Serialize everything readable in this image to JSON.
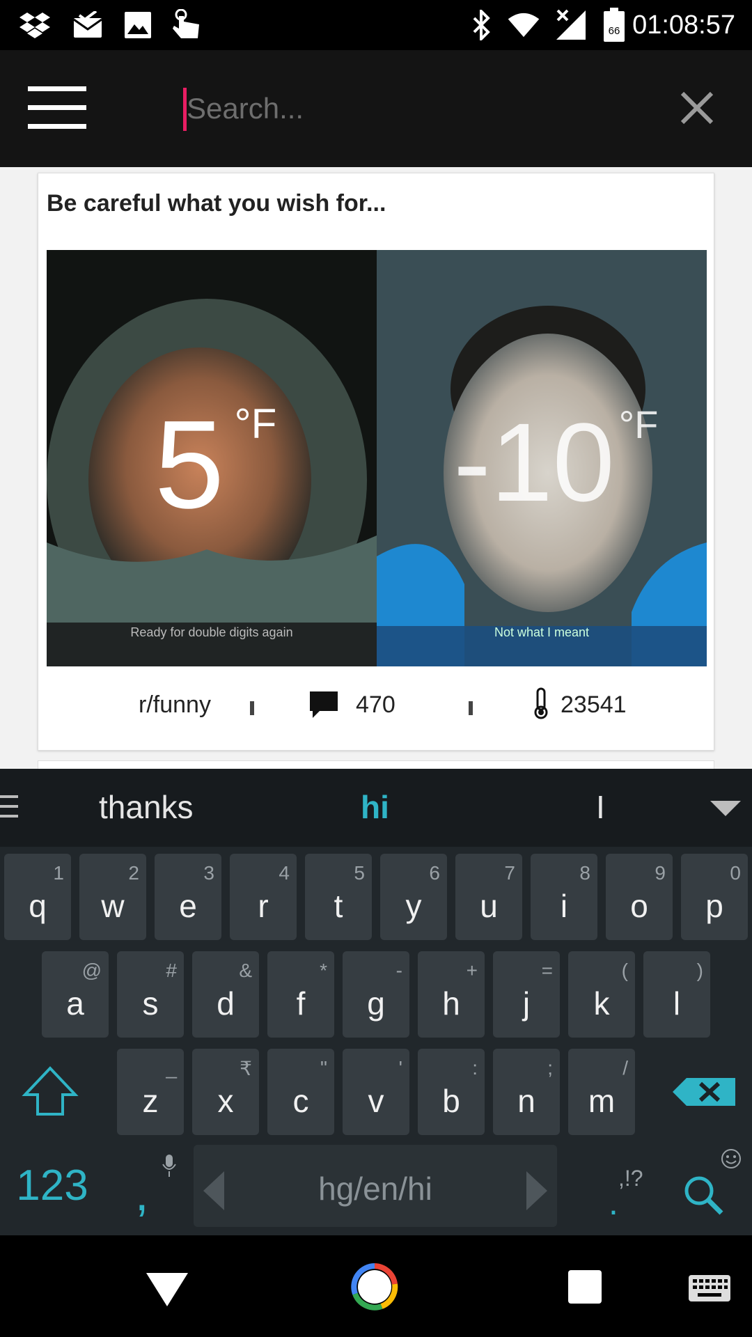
{
  "status_bar": {
    "time": "01:08:57",
    "battery_level": "66",
    "icons": [
      "dropbox-icon",
      "mail-icon",
      "image-icon",
      "touch-icon",
      "bluetooth-icon",
      "wifi-icon",
      "signal-icon",
      "battery-icon"
    ]
  },
  "app_bar": {
    "menu_icon": "hamburger-menu-icon",
    "search_placeholder": "Search...",
    "close_icon": "close-icon"
  },
  "post": {
    "title": "Be careful what you wish for...",
    "image_left_text": "5",
    "image_left_unit": "°F",
    "image_left_caption": "Ready for double digits again",
    "image_right_text": "-10",
    "image_right_unit": "°F",
    "image_right_caption": "Not what I meant",
    "subreddit": "r/funny",
    "comments": "470",
    "score": "23541"
  },
  "keyboard": {
    "suggestions": {
      "left": "thanks",
      "center": "hi",
      "right": "I"
    },
    "row1": [
      {
        "letter": "q",
        "hint": "1"
      },
      {
        "letter": "w",
        "hint": "2"
      },
      {
        "letter": "e",
        "hint": "3"
      },
      {
        "letter": "r",
        "hint": "4"
      },
      {
        "letter": "t",
        "hint": "5"
      },
      {
        "letter": "y",
        "hint": "6"
      },
      {
        "letter": "u",
        "hint": "7"
      },
      {
        "letter": "i",
        "hint": "8"
      },
      {
        "letter": "o",
        "hint": "9"
      },
      {
        "letter": "p",
        "hint": "0"
      }
    ],
    "row2": [
      {
        "letter": "a",
        "hint": "@"
      },
      {
        "letter": "s",
        "hint": "#"
      },
      {
        "letter": "d",
        "hint": "&"
      },
      {
        "letter": "f",
        "hint": "*"
      },
      {
        "letter": "g",
        "hint": "-"
      },
      {
        "letter": "h",
        "hint": "+"
      },
      {
        "letter": "j",
        "hint": "="
      },
      {
        "letter": "k",
        "hint": "("
      },
      {
        "letter": "l",
        "hint": ")"
      }
    ],
    "row3": [
      {
        "letter": "z",
        "hint": "_"
      },
      {
        "letter": "x",
        "hint": "₹"
      },
      {
        "letter": "c",
        "hint": "\""
      },
      {
        "letter": "v",
        "hint": "'"
      },
      {
        "letter": "b",
        "hint": ":"
      },
      {
        "letter": "n",
        "hint": ";"
      },
      {
        "letter": "m",
        "hint": "/"
      }
    ],
    "num_label": "123",
    "comma_label": ",",
    "space_label": "hg/en/hi",
    "punct_top": ",!?",
    "punct_main": ".",
    "accent_color": "#2fb4c6"
  },
  "nav_bar": {
    "icons": [
      "back-icon",
      "home-icon",
      "recents-icon",
      "keyboard-icon"
    ]
  }
}
